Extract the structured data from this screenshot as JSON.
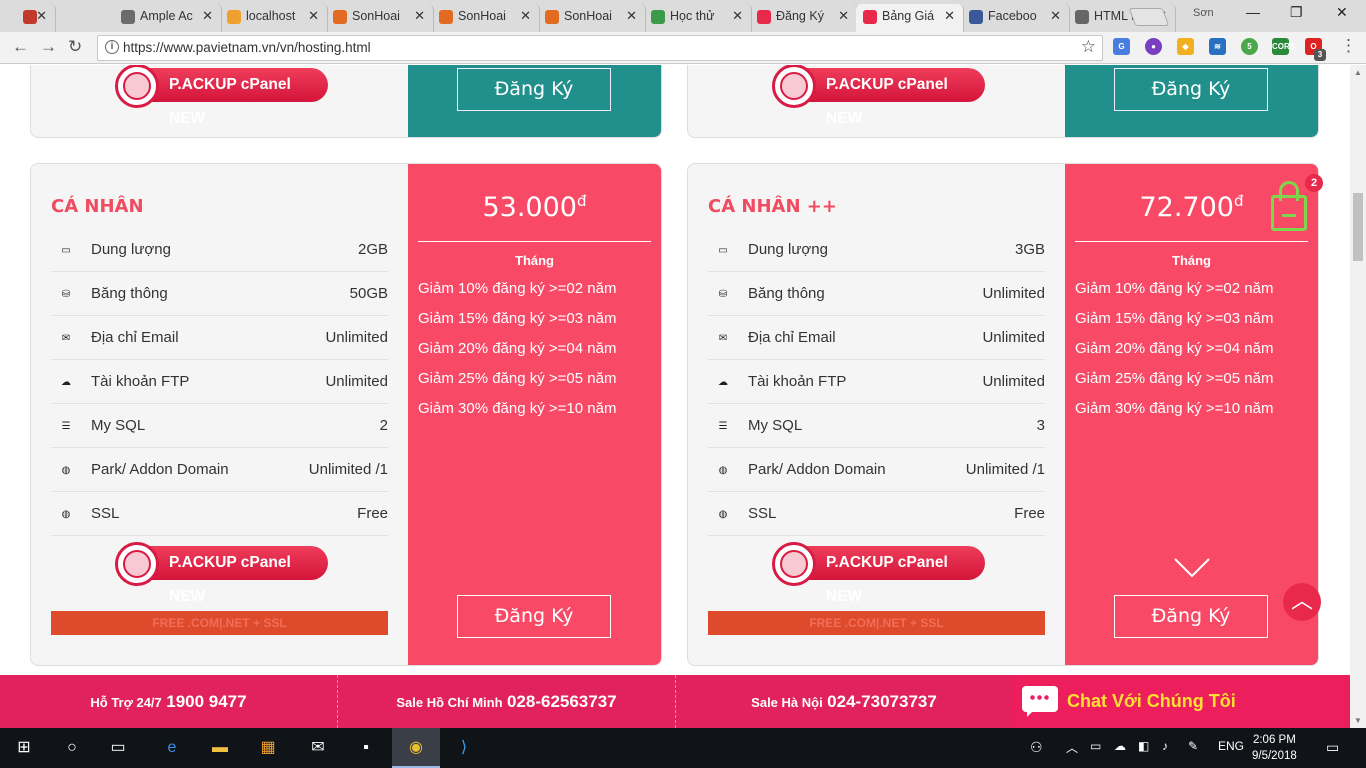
{
  "browser": {
    "tabs": [
      {
        "label": "",
        "favicon_color": "#c0392b"
      },
      {
        "label": "Ample Ac",
        "favicon_color": "#6b6b6b"
      },
      {
        "label": "localhost",
        "favicon_color": "#f0a030"
      },
      {
        "label": "SonHoai",
        "favicon_color": "#e36b21"
      },
      {
        "label": "SonHoai",
        "favicon_color": "#e36b21"
      },
      {
        "label": "SonHoai",
        "favicon_color": "#e36b21"
      },
      {
        "label": "Học thử",
        "favicon_color": "#3c9b4a"
      },
      {
        "label": "Đăng Ký",
        "favicon_color": "#e8294c"
      },
      {
        "label": "Bảng Giá",
        "favicon_color": "#e8294c",
        "active": true
      },
      {
        "label": "Faceboo",
        "favicon_color": "#3b5998"
      },
      {
        "label": "HTML to",
        "favicon_color": "#666666"
      }
    ],
    "close_glyph": "✕",
    "profile": "Sơn",
    "window_controls": [
      "—",
      "❐",
      "✕"
    ],
    "url": "https://www.pavietnam.vn/vn/hosting.html",
    "extensions_badge": "3"
  },
  "page": {
    "top_cards": [
      {
        "pack_label": "P.ACKUP cPanel NEW",
        "button": "Đăng Ký"
      },
      {
        "pack_label": "P.ACKUP cPanel NEW",
        "button": "Đăng Ký"
      }
    ],
    "plans": [
      {
        "title": "CÁ NHÂN",
        "price": "53.000",
        "currency": "đ",
        "period": "Tháng",
        "features": [
          {
            "icon": "hdd-icon",
            "label": "Dung lượng",
            "value": "2GB"
          },
          {
            "icon": "bandwidth-icon",
            "label": "Băng thông",
            "value": "50GB"
          },
          {
            "icon": "email-icon",
            "label": "Địa chỉ Email",
            "value": "Unlimited"
          },
          {
            "icon": "ftp-icon",
            "label": "Tài khoản FTP",
            "value": "Unlimited"
          },
          {
            "icon": "database-icon",
            "label": "My SQL",
            "value": "2"
          },
          {
            "icon": "www-icon",
            "label": "Park/ Addon Domain",
            "value": "Unlimited /1"
          },
          {
            "icon": "ssl-icon",
            "label": "SSL",
            "value": "Free"
          }
        ],
        "discounts": [
          "Giảm 10% đăng ký >=02 năm",
          "Giảm 15% đăng ký >=03 năm",
          "Giảm 20% đăng ký >=04 năm",
          "Giảm 25% đăng ký >=05 năm",
          "Giảm 30% đăng ký >=10 năm"
        ],
        "pack_label": "P.ACKUP cPanel NEW",
        "free_banner": "FREE .COM|.NET + SSL",
        "button": "Đăng Ký"
      },
      {
        "title": "CÁ NHÂN ++",
        "price": "72.700",
        "currency": "đ",
        "period": "Tháng",
        "features": [
          {
            "icon": "hdd-icon",
            "label": "Dung lượng",
            "value": "3GB"
          },
          {
            "icon": "bandwidth-icon",
            "label": "Băng thông",
            "value": "Unlimited"
          },
          {
            "icon": "email-icon",
            "label": "Địa chỉ Email",
            "value": "Unlimited"
          },
          {
            "icon": "ftp-icon",
            "label": "Tài khoản FTP",
            "value": "Unlimited"
          },
          {
            "icon": "database-icon",
            "label": "My SQL",
            "value": "3"
          },
          {
            "icon": "www-icon",
            "label": "Park/ Addon Domain",
            "value": "Unlimited /1"
          },
          {
            "icon": "ssl-icon",
            "label": "SSL",
            "value": "Free"
          }
        ],
        "discounts": [
          "Giảm 10% đăng ký >=02 năm",
          "Giảm 15% đăng ký >=03 năm",
          "Giảm 20% đăng ký >=04 năm",
          "Giảm 25% đăng ký >=05 năm",
          "Giảm 30% đăng ký >=10 năm"
        ],
        "pack_label": "P.ACKUP cPanel NEW",
        "free_banner": "FREE .COM|.NET + SSL",
        "button": "Đăng Ký"
      }
    ],
    "cart_count": "2",
    "footer": {
      "support_label": "Hỗ Trợ 24/7",
      "support_number": "1900 9477",
      "hcm_label": "Sale Hồ Chí Minh",
      "hcm_number": "028-62563737",
      "hn_label": "Sale Hà Nội",
      "hn_number": "024-73073737",
      "chat_label": "Chat Với Chúng Tôi"
    }
  },
  "taskbar": {
    "language": "ENG",
    "time": "2:06 PM",
    "date": "9/5/2018"
  },
  "colors": {
    "accent_pink": "#f84a66",
    "teal": "#21908c",
    "footer_pink": "#e2215f",
    "chat_yellow": "#ffe033"
  }
}
